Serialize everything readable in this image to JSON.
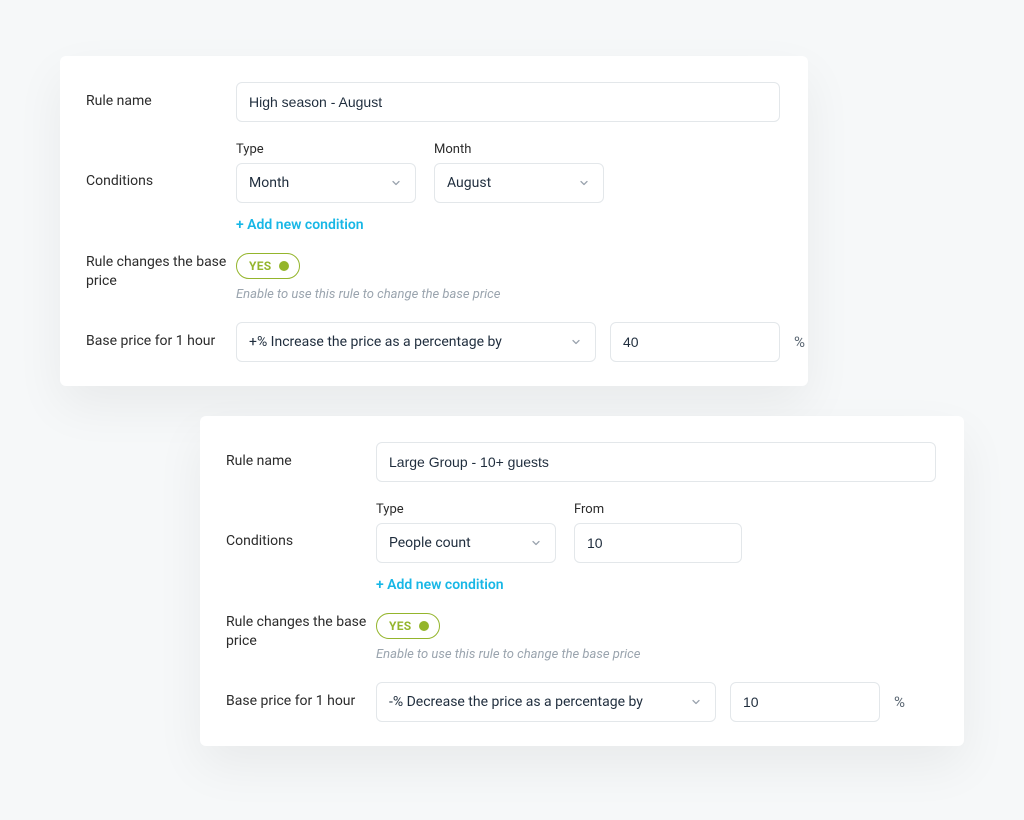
{
  "labels": {
    "rule_name": "Rule name",
    "conditions": "Conditions",
    "changes_base": "Rule changes the base price",
    "base_price_hour": "Base price for 1 hour",
    "type": "Type",
    "month": "Month",
    "from": "From"
  },
  "common": {
    "add_condition": "+ Add new condition",
    "toggle_yes": "YES",
    "helper": "Enable to use this rule to change the base price",
    "percent": "%"
  },
  "card1": {
    "rule_name_value": "High season - August",
    "type_value": "Month",
    "month_value": "August",
    "operation_label": "+% Increase the price as a percentage by",
    "amount": "40"
  },
  "card2": {
    "rule_name_value": "Large Group - 10+ guests",
    "type_value": "People count",
    "from_value": "10",
    "operation_label": "-% Decrease the price as a percentage by",
    "amount": "10"
  }
}
